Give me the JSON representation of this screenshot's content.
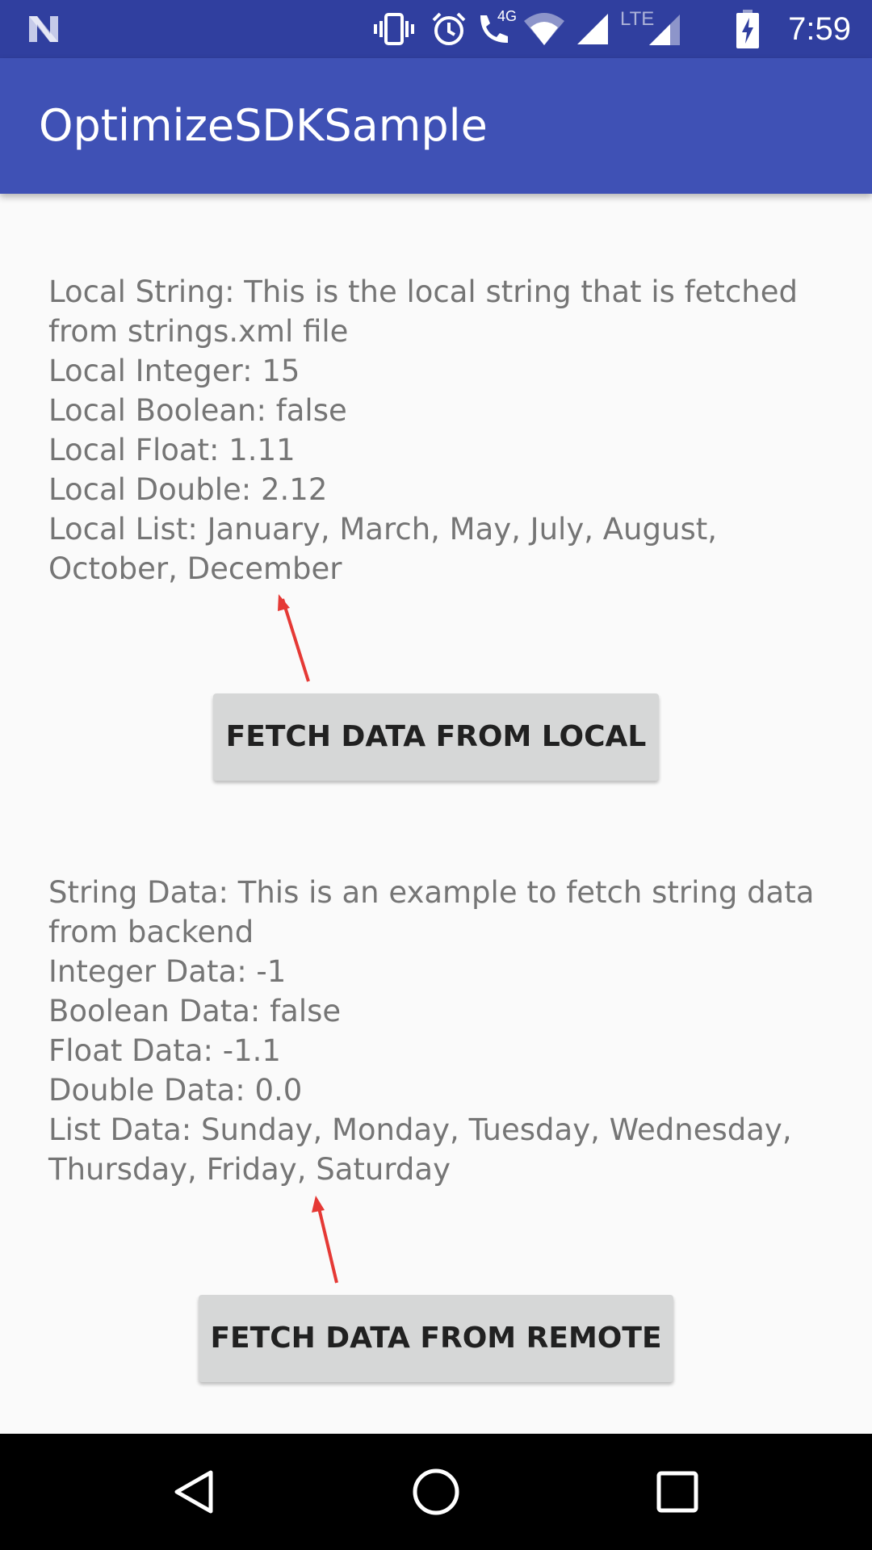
{
  "status_bar": {
    "time": "7:59",
    "icons": [
      "notification-n-icon",
      "vibrate-icon",
      "alarm-icon",
      "volte-call-icon",
      "wifi-icon",
      "signal-icon",
      "lte-signal-icon",
      "battery-charging-icon"
    ],
    "call_badge": "4G",
    "lte_label": "LTE"
  },
  "app_bar": {
    "title": "OptimizeSDKSample"
  },
  "local": {
    "string_line": "Local String: This is the local string that is fetched from strings.xml file",
    "integer_line": "Local Integer: 15",
    "boolean_line": "Local Boolean: false",
    "float_line": "Local Float: 1.11",
    "double_line": "Local Double: 2.12",
    "list_line": "Local List: January, March, May, July, August, October, December",
    "button_label": "FETCH DATA FROM LOCAL"
  },
  "remote": {
    "string_line": "String Data: This is an example to fetch string data from backend",
    "integer_line": "Integer Data: -1",
    "boolean_line": "Boolean Data: false",
    "float_line": "Float Data: -1.1",
    "double_line": "Double Data: 0.0",
    "list_line": "List Data: Sunday, Monday, Tuesday, Wednesday, Thursday, Friday, Saturday",
    "button_label": "FETCH DATA FROM REMOTE"
  },
  "annotation_color": "#E53935",
  "nav_bar": {
    "icons": [
      "back-icon",
      "home-icon",
      "recents-icon"
    ]
  }
}
